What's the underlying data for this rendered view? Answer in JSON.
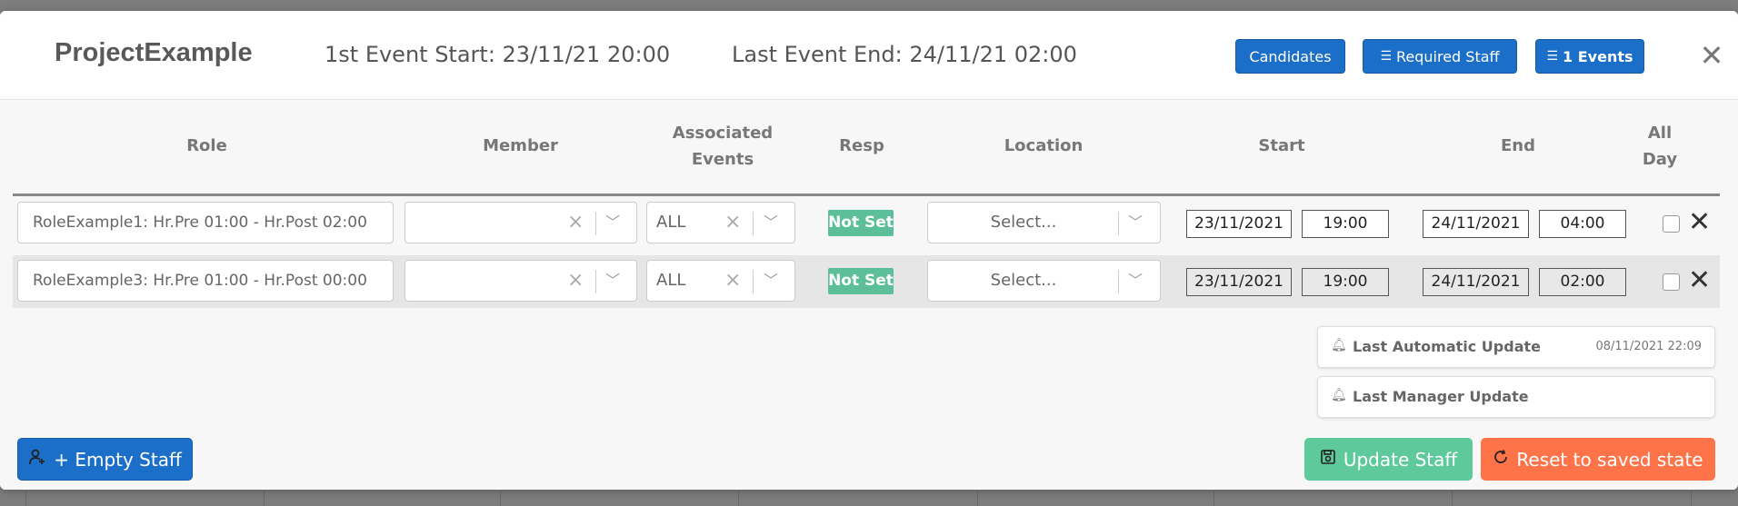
{
  "header": {
    "project_title": "ProjectExample",
    "first_event_start": "1st Event Start: 23/11/21 20:00",
    "last_event_end": "Last Event End: 24/11/21 02:00",
    "buttons": {
      "candidates": "Candidates",
      "required_staff": "Required Staff",
      "events": "1 Events"
    },
    "close_symbol": "✕"
  },
  "table": {
    "columns": {
      "role": "Role",
      "member": "Member",
      "associated_events_1": "Associated",
      "associated_events_2": "Events",
      "resp": "Resp",
      "location": "Location",
      "start": "Start",
      "end": "End",
      "all_day_1": "All",
      "all_day_2": "Day"
    },
    "rows": [
      {
        "role": "RoleExample1: Hr.Pre 01:00 - Hr.Post 02:00",
        "member": "",
        "associated_events": "ALL",
        "resp": "Not Set",
        "location_placeholder": "Select...",
        "start_date": "23/11/2021",
        "start_time": "19:00",
        "end_date": "24/11/2021",
        "end_time": "04:00",
        "all_day": false
      },
      {
        "role": "RoleExample3: Hr.Pre 01:00 - Hr.Post 00:00",
        "member": "",
        "associated_events": "ALL",
        "resp": "Not Set",
        "location_placeholder": "Select...",
        "start_date": "23/11/2021",
        "start_time": "19:00",
        "end_date": "24/11/2021",
        "end_time": "02:00",
        "all_day": false
      }
    ]
  },
  "updates": {
    "automatic_label": "Last Automatic Update",
    "automatic_time": "08/11/2021 22:09",
    "manager_label": "Last Manager Update"
  },
  "actions": {
    "empty_staff": "+ Empty Staff",
    "update_staff": "Update Staff",
    "reset": "Reset to saved state"
  },
  "colors": {
    "primary_blue": "#1b6fc8",
    "resp_green": "#5cbf9a",
    "update_green": "#5ec99b",
    "reset_orange": "#ff7349"
  },
  "icons": {
    "list": "list-icon",
    "bell": "bell-icon",
    "add_user": "add-user-icon",
    "save": "save-icon",
    "refresh": "refresh-icon",
    "close": "close-icon"
  }
}
